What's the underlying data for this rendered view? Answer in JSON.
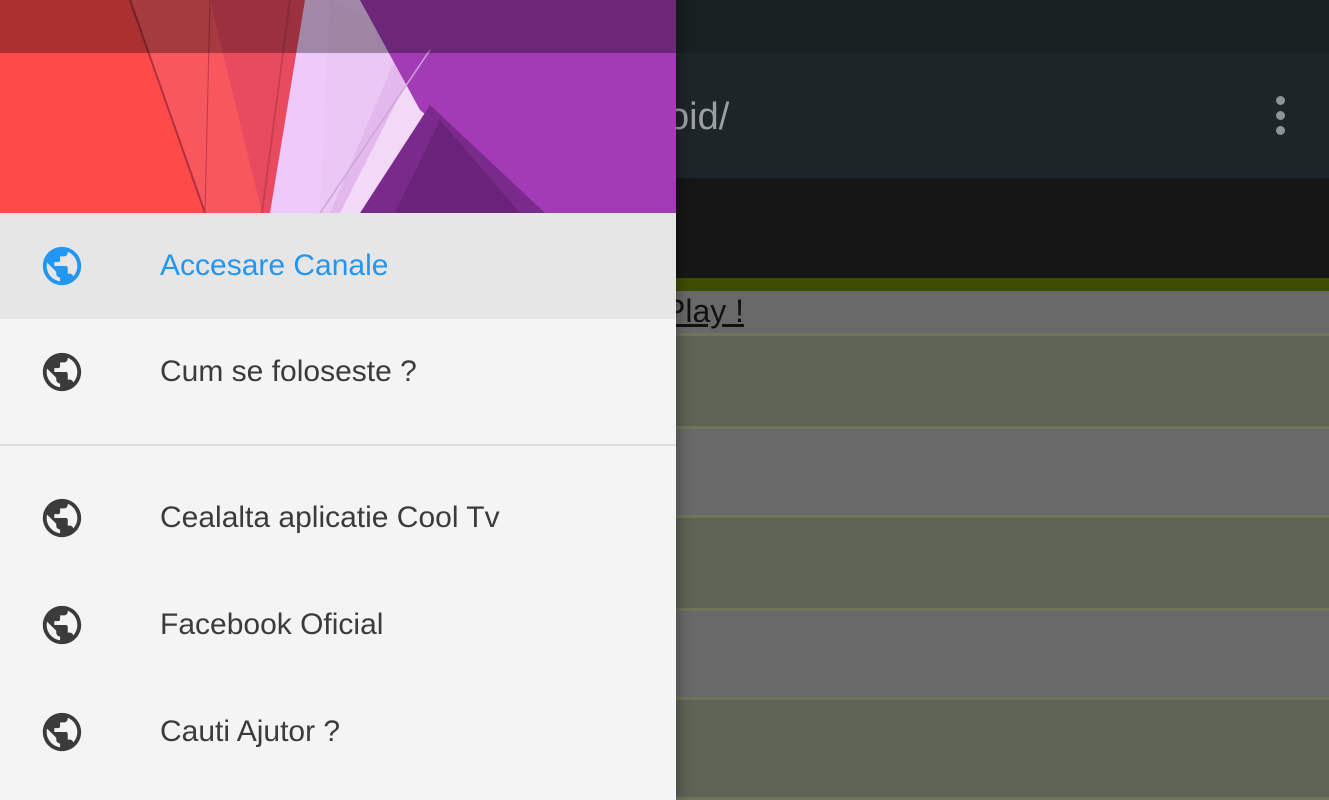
{
  "background_app": {
    "toolbar_title": "oid/",
    "list_link_text": "Play !"
  },
  "drawer": {
    "items": [
      {
        "label": "Accesare Canale",
        "icon": "globe-icon",
        "selected": true
      },
      {
        "label": "Cum se foloseste ?",
        "icon": "globe-icon",
        "selected": false
      },
      {
        "label": "Cealalta aplicatie Cool Tv",
        "icon": "globe-icon",
        "selected": false
      },
      {
        "label": "Facebook Oficial",
        "icon": "globe-icon",
        "selected": false
      },
      {
        "label": "Cauti Ajutor ?",
        "icon": "globe-icon",
        "selected": false
      }
    ]
  },
  "colors": {
    "accent": "#2196f3",
    "drawer_background": "#f4f4f4",
    "selected_row": "#e6e6e6",
    "icon_default": "#3b3b3b"
  }
}
